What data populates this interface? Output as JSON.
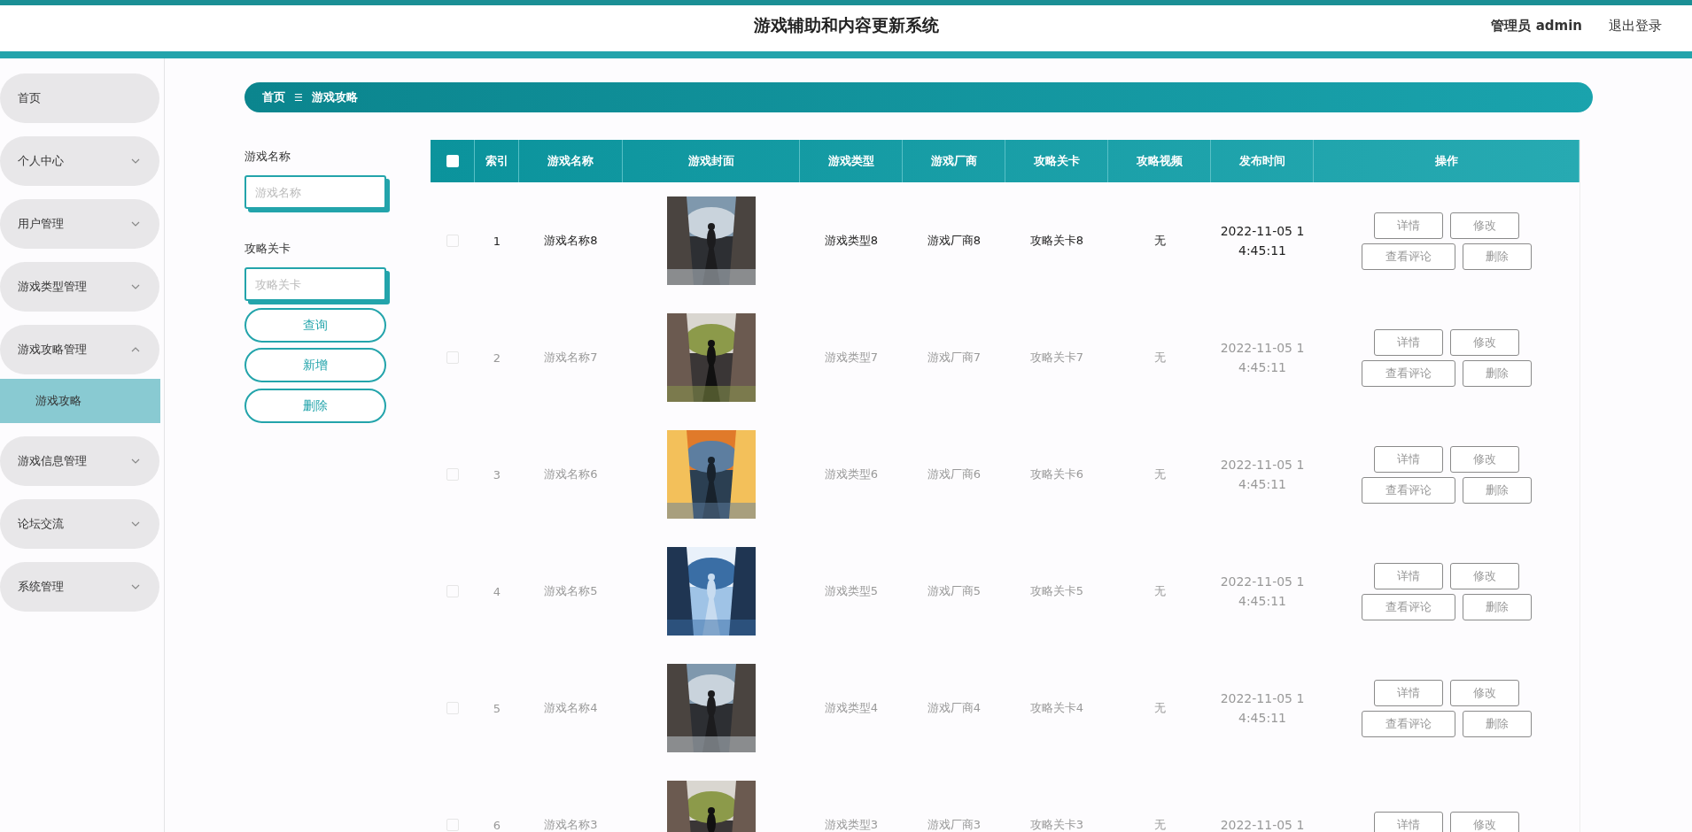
{
  "header": {
    "title": "游戏辅助和内容更新系统",
    "user": "管理员 admin",
    "logout": "退出登录"
  },
  "sidebar": {
    "items": [
      {
        "label": "首页"
      },
      {
        "label": "个人中心",
        "expanded": false
      },
      {
        "label": "用户管理",
        "expanded": false
      },
      {
        "label": "游戏类型管理",
        "expanded": false
      },
      {
        "label": "游戏攻略管理",
        "expanded": true,
        "children": [
          {
            "label": "游戏攻略",
            "selected": true
          }
        ]
      },
      {
        "label": "游戏信息管理",
        "expanded": false
      },
      {
        "label": "论坛交流",
        "expanded": false
      },
      {
        "label": "系统管理",
        "expanded": false
      }
    ]
  },
  "breadcrumb": {
    "home": "首页",
    "separator": "☰",
    "current": "游戏攻略"
  },
  "search": {
    "fields": [
      {
        "label": "游戏名称",
        "placeholder": "游戏名称"
      },
      {
        "label": "攻略关卡",
        "placeholder": "攻略关卡"
      }
    ],
    "buttons": [
      "查询",
      "新增",
      "删除"
    ]
  },
  "table": {
    "select_all": {
      "checked": false
    },
    "columns": [
      "索引",
      "游戏名称",
      "游戏封面",
      "游戏类型",
      "游戏厂商",
      "攻略关卡",
      "攻略视频",
      "发布时间",
      "操作"
    ],
    "rows": [
      {
        "index": "1",
        "name": "游戏名称8",
        "cover": {
          "kind": "picture"
        },
        "type": "游戏类型8",
        "vendor": "游戏厂商8",
        "level": "攻略关卡8",
        "video": "无",
        "time": [
          "2022-11-05 1",
          "4:45:11"
        ],
        "hovered": true,
        "checked": false,
        "actions": [
          [
            "详情",
            "修改"
          ],
          [
            "查看评论",
            "删除"
          ]
        ]
      },
      {
        "index": "2",
        "name": "游戏名称7",
        "cover": {
          "kind": "picture"
        },
        "type": "游戏类型7",
        "vendor": "游戏厂商7",
        "level": "攻略关卡7",
        "video": "无",
        "time": [
          "2022-11-05 1",
          "4:45:11"
        ],
        "hovered": false,
        "checked": false,
        "actions": [
          [
            "详情",
            "修改"
          ],
          [
            "查看评论",
            "删除"
          ]
        ]
      },
      {
        "index": "3",
        "name": "游戏名称6",
        "cover": {
          "kind": "picture"
        },
        "type": "游戏类型6",
        "vendor": "游戏厂商6",
        "level": "攻略关卡6",
        "video": "无",
        "time": [
          "2022-11-05 1",
          "4:45:11"
        ],
        "hovered": false,
        "checked": false,
        "actions": [
          [
            "详情",
            "修改"
          ],
          [
            "查看评论",
            "删除"
          ]
        ]
      },
      {
        "index": "4",
        "name": "游戏名称5",
        "cover": {
          "kind": "picture"
        },
        "type": "游戏类型5",
        "vendor": "游戏厂商5",
        "level": "攻略关卡5",
        "video": "无",
        "time": [
          "2022-11-05 1",
          "4:45:11"
        ],
        "hovered": false,
        "checked": false,
        "actions": [
          [
            "详情",
            "修改"
          ],
          [
            "查看评论",
            "删除"
          ]
        ]
      },
      {
        "index": "5",
        "name": "游戏名称4",
        "cover": {
          "kind": "picture"
        },
        "type": "游戏类型4",
        "vendor": "游戏厂商4",
        "level": "攻略关卡4",
        "video": "无",
        "time": [
          "2022-11-05 1",
          "4:45:11"
        ],
        "hovered": false,
        "checked": false,
        "actions": [
          [
            "详情",
            "修改"
          ],
          [
            "查看评论",
            "删除"
          ]
        ]
      },
      {
        "index": "6",
        "name": "游戏名称3",
        "cover": {
          "kind": "picture"
        },
        "type": "游戏类型3",
        "vendor": "游戏厂商3",
        "level": "攻略关卡3",
        "video": "无",
        "time": [
          "2022-11-05 1"
        ],
        "hovered": false,
        "checked": false,
        "actions": [
          [
            "详情",
            "修改"
          ]
        ]
      }
    ]
  }
}
